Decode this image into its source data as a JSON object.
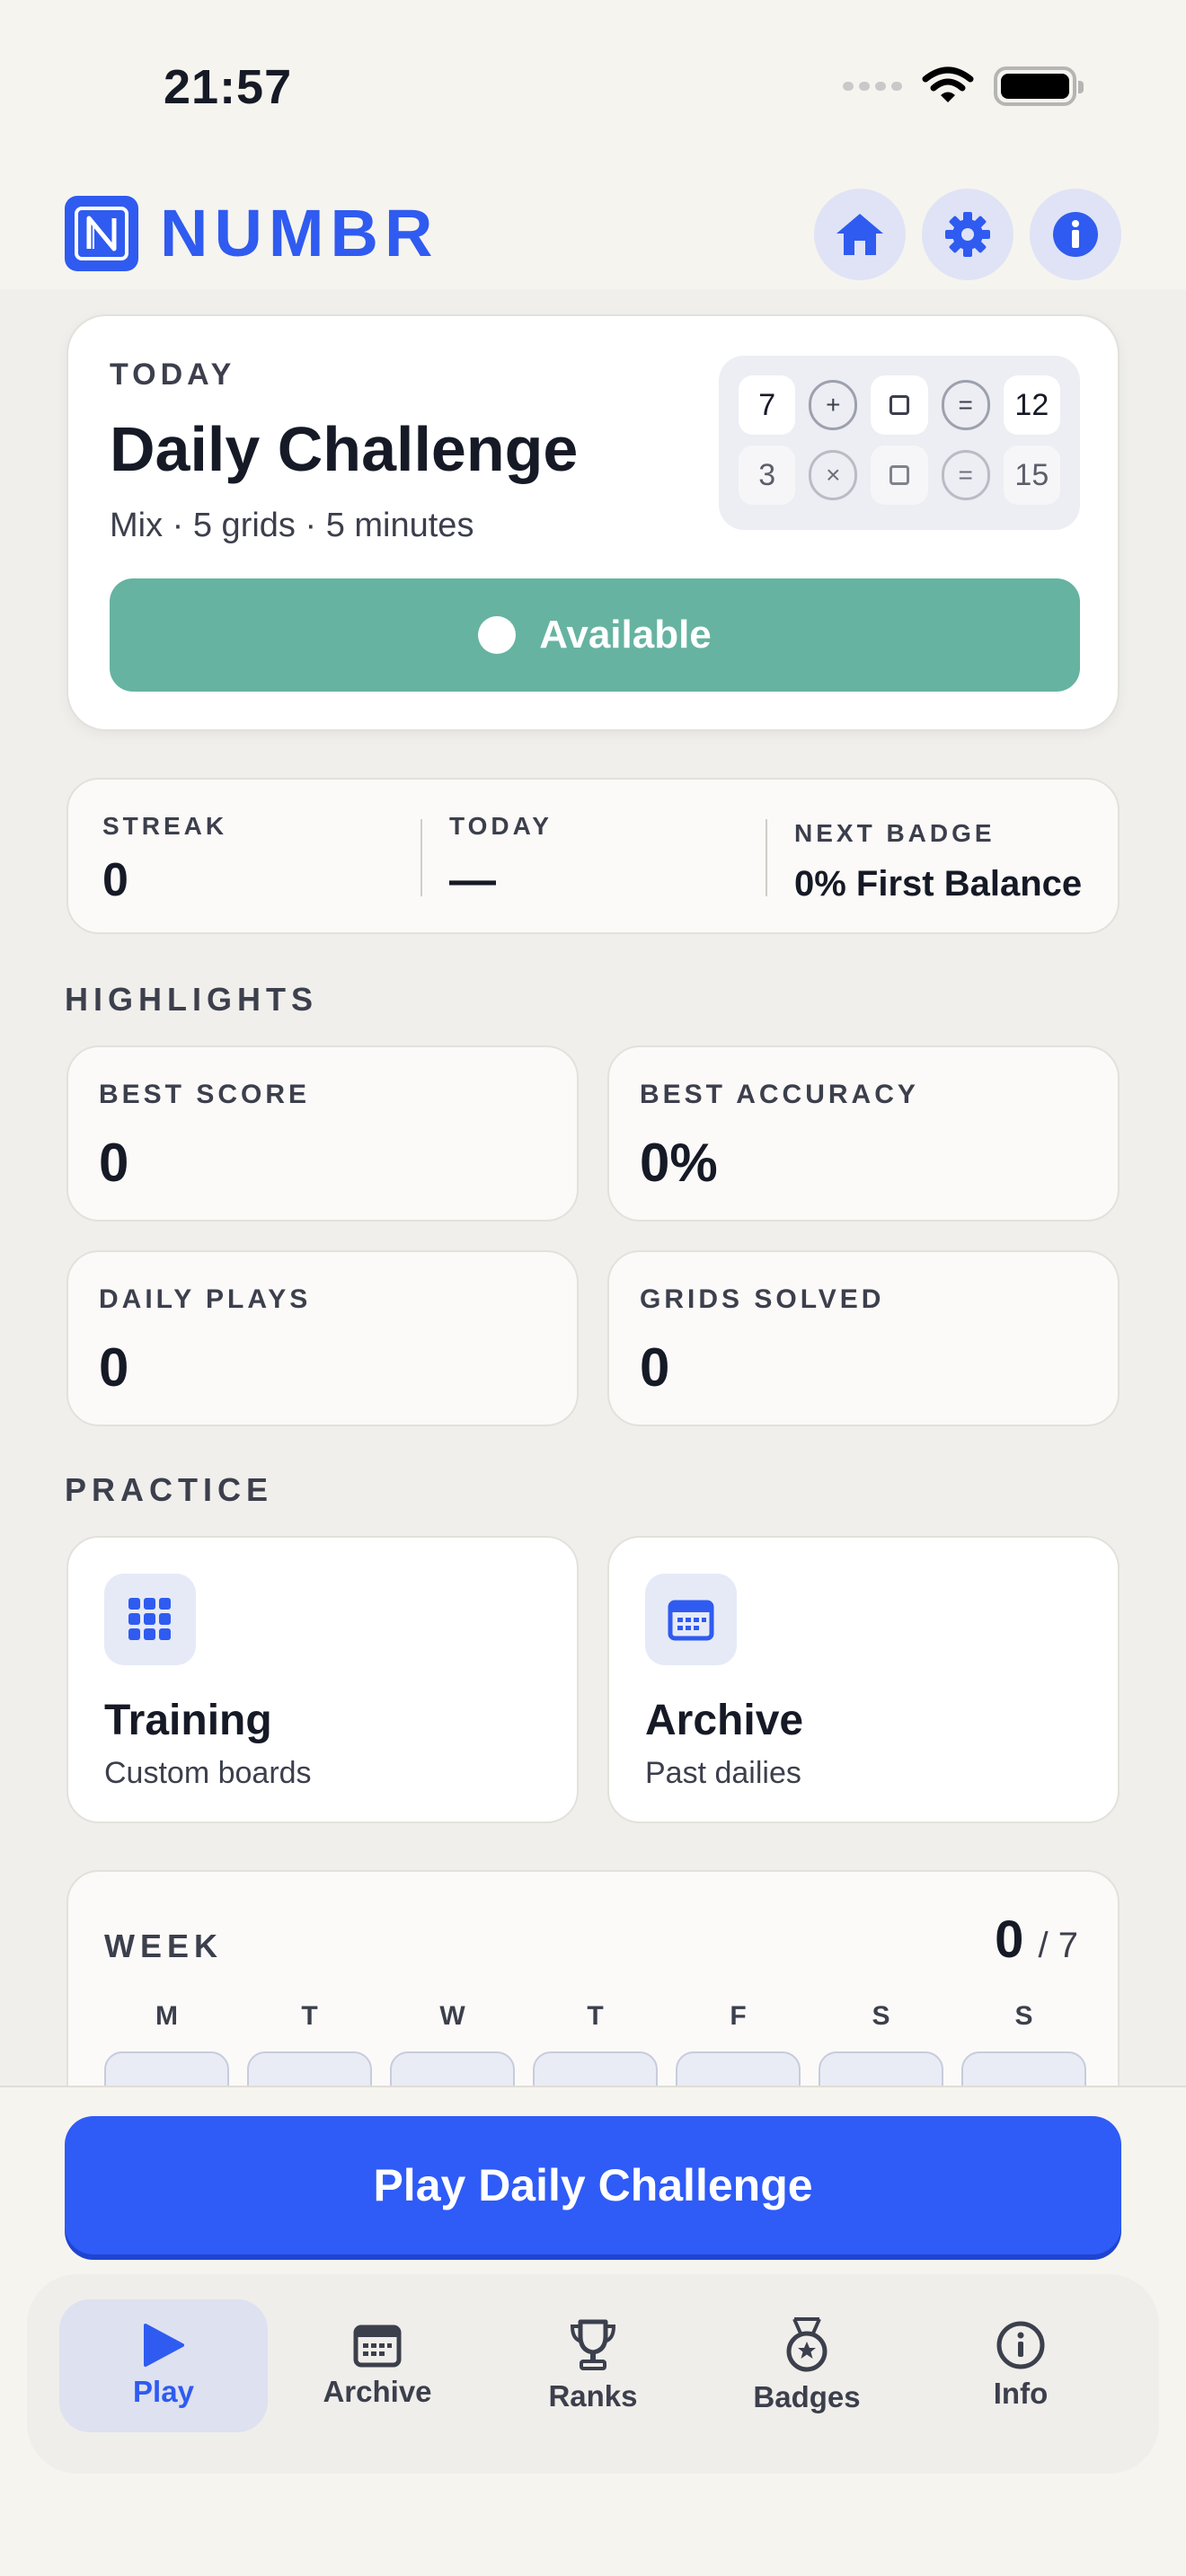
{
  "status_bar": {
    "time": "21:57"
  },
  "header": {
    "app_name": "NUMBR"
  },
  "daily": {
    "eyebrow": "TODAY",
    "title": "Daily Challenge",
    "meta": "Mix · 5 grids · 5 minutes",
    "preview": {
      "row1": {
        "a": "7",
        "op": "+",
        "eq": "=",
        "result": "12"
      },
      "row2": {
        "a": "3",
        "op": "×",
        "eq": "=",
        "result": "15"
      }
    },
    "status_label": "Available"
  },
  "stats": {
    "streak": {
      "label": "STREAK",
      "value": "0"
    },
    "today": {
      "label": "TODAY",
      "value": "—"
    },
    "next_badge": {
      "label": "NEXT BADGE",
      "value": "0% First Balance"
    }
  },
  "highlights": {
    "title": "HIGHLIGHTS",
    "best_score": {
      "label": "BEST SCORE",
      "value": "0"
    },
    "best_accuracy": {
      "label": "BEST ACCURACY",
      "value": "0%"
    },
    "daily_plays": {
      "label": "DAILY PLAYS",
      "value": "0"
    },
    "grids_solved": {
      "label": "GRIDS SOLVED",
      "value": "0"
    }
  },
  "practice": {
    "title": "PRACTICE",
    "training": {
      "title": "Training",
      "subtitle": "Custom boards"
    },
    "archive": {
      "title": "Archive",
      "subtitle": "Past dailies"
    }
  },
  "week": {
    "label": "WEEK",
    "completed": "0",
    "total": "/ 7",
    "days": [
      "M",
      "T",
      "W",
      "T",
      "F",
      "S",
      "S"
    ]
  },
  "cta": {
    "label": "Play Daily Challenge"
  },
  "tabs": [
    "Play",
    "Archive",
    "Ranks",
    "Badges",
    "Info"
  ],
  "colors": {
    "accent": "#2f5bf0",
    "available": "#66b3a1",
    "background": "#f6f4ef"
  }
}
